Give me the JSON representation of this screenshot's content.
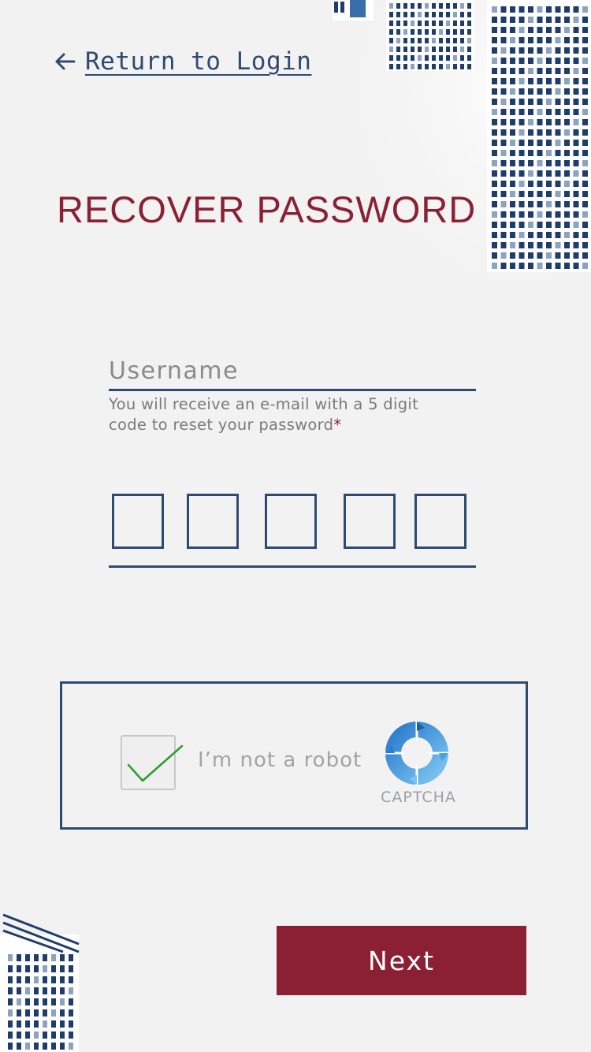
{
  "nav": {
    "back_label": "Return to Login"
  },
  "page": {
    "title": "RECOVER PASSWORD"
  },
  "form": {
    "username": {
      "placeholder": "Username",
      "value": ""
    },
    "hint": "You will receive an e-mail with a 5 digit code to reset your password",
    "required_marker": "*",
    "code_digits": [
      "",
      "",
      "",
      "",
      ""
    ]
  },
  "captcha": {
    "label": "I’m not a robot",
    "brand": "CAPTCHA",
    "checked": true
  },
  "actions": {
    "next_label": "Next"
  },
  "colors": {
    "accent": "#8b2034",
    "primary": "#2e4a73",
    "background": "#f2f2f2",
    "check": "#2c9e2c",
    "captcha_logo": "#4a9fdc"
  }
}
